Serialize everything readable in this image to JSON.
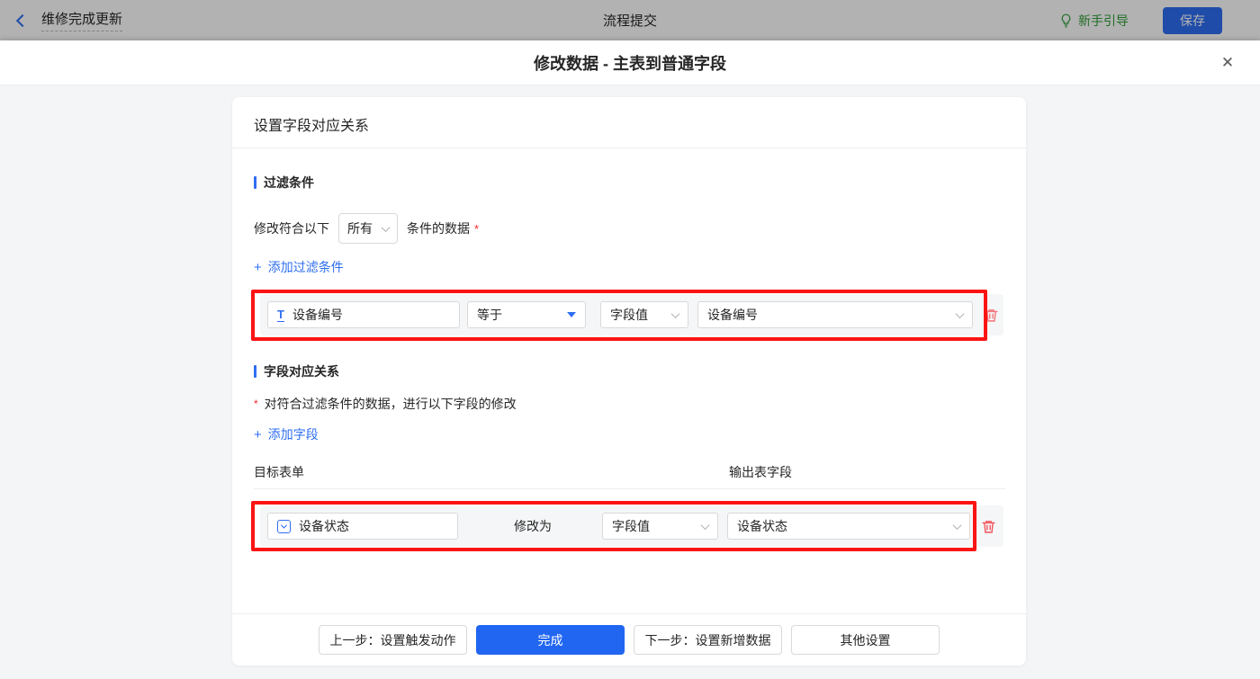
{
  "icons": {
    "plus": "+",
    "close": "✕",
    "text_field": "T"
  },
  "colors": {
    "brand_blue": "#2e6ef2",
    "guide_green": "#2f9e36",
    "annotation_red": "#fb1414",
    "danger_red": "#f2535b",
    "asterisk_red": "#f5222d"
  },
  "topbar": {
    "back_icon": "chevron-left",
    "title": "维修完成更新",
    "center_title": "流程提交",
    "guide_label": "新手引导",
    "save_label": "保存"
  },
  "modal": {
    "title": "修改数据 - 主表到普通字段",
    "card": {
      "header": "设置字段对应关系",
      "filter_section": {
        "title": "过滤条件",
        "condition_prefix": "修改符合以下",
        "condition_select_value": "所有",
        "condition_suffix": "条件的数据",
        "required_mark": "*",
        "add_link": "添加过滤条件",
        "row": {
          "field": "设备编号",
          "field_type_icon": "text-field",
          "operator": "等于",
          "value_type": "字段值",
          "value_field": "设备编号"
        }
      },
      "mapping_section": {
        "title": "字段对应关系",
        "required_mark": "*",
        "description": "对符合过滤条件的数据，进行以下字段的修改",
        "add_link": "添加字段",
        "columns": {
          "target": "目标表单",
          "output": "输出表字段"
        },
        "row": {
          "field": "设备状态",
          "field_type_icon": "select-field",
          "middle_label": "修改为",
          "value_type": "字段值",
          "value_field": "设备状态"
        }
      },
      "footer": {
        "prev_label": "上一步：设置触发动作",
        "done_label": "完成",
        "next_label": "下一步：设置新增数据",
        "other_label": "其他设置"
      }
    }
  }
}
